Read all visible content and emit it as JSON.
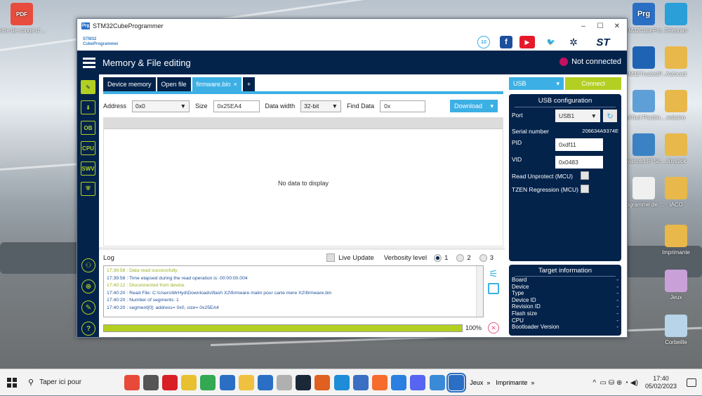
{
  "desktop": {
    "left_icons": [
      {
        "label": "lettre de congé d'un bail non ...",
        "color": "#e74c3c",
        "badge": "PDF"
      }
    ],
    "right_icons": [
      {
        "label": "STM32CubePro...",
        "color": "#2b6fc4",
        "badge": "Prg"
      },
      {
        "label": "Telegram",
        "color": "#2a9fd8",
        "badge": ""
      },
      {
        "label": "STM32TrustedP...",
        "color": "#1f63b5",
        "badge": ""
      },
      {
        "label": "Autocad",
        "color": "#e8b84a",
        "badge": ""
      },
      {
        "label": "MiniTool Partition Wizard",
        "color": "#5f9fd8",
        "badge": ""
      },
      {
        "label": "arduino",
        "color": "#e8b84a",
        "badge": ""
      },
      {
        "label": "Advanced IP Scanner",
        "color": "#3a82c4",
        "badge": ""
      },
      {
        "label": "Joystick",
        "color": "#e8b84a",
        "badge": ""
      },
      {
        "label": "Programme de base relais",
        "color": "#f0f0f0",
        "badge": ""
      },
      {
        "label": "IACO",
        "color": "#e8b84a",
        "badge": ""
      },
      {
        "label": "Imprimante",
        "color": "#e8b84a",
        "badge": ""
      },
      {
        "label": "Jeux",
        "color": "#c9a0d8",
        "badge": ""
      },
      {
        "label": "Corbeille",
        "color": "#b8d4e8",
        "badge": ""
      }
    ]
  },
  "window": {
    "title": "STM32CubeProgrammer",
    "app_badge": "Prg",
    "brand": "STM32CubeProgrammer",
    "brand_logo": [
      "STM32",
      "CubeProgrammer"
    ],
    "controls": {
      "minimize": "–",
      "maximize": "☐",
      "close": "✕"
    },
    "social": {
      "anniversary": "10",
      "facebook": "f",
      "youtube": "▶",
      "twitter": "🐦",
      "network": "✲",
      "st_logo": "ST"
    }
  },
  "header": {
    "title": "Memory & File editing",
    "connection_status": "Not connected"
  },
  "sidebar": [
    {
      "name": "memory-edit",
      "glyph": "✎"
    },
    {
      "name": "erase-program",
      "glyph": "⬇"
    },
    {
      "name": "option-bytes",
      "glyph": "OB"
    },
    {
      "name": "cpu",
      "glyph": "CPU"
    },
    {
      "name": "swv",
      "glyph": "SWV"
    },
    {
      "name": "security",
      "glyph": "⛨"
    }
  ],
  "sidebar_bottom": [
    {
      "name": "notification",
      "glyph": "⚇"
    },
    {
      "name": "debug",
      "glyph": "⊛"
    },
    {
      "name": "edit",
      "glyph": "✎"
    },
    {
      "name": "help",
      "glyph": "?"
    }
  ],
  "main": {
    "tabs": [
      {
        "label": "Device memory",
        "active": false
      },
      {
        "label": "Open file",
        "active": false
      },
      {
        "label": "firmware.bin",
        "active": true,
        "closable": "×"
      },
      {
        "label": "+",
        "active": false
      }
    ],
    "address_label": "Address",
    "address_value": "0x0",
    "size_label": "Size",
    "size_value": "0x25EA4",
    "data_width_label": "Data width",
    "data_width_value": "32-bit",
    "find_label": "Find Data",
    "find_value": "0x",
    "download_label": "Download",
    "no_data": "No data to display"
  },
  "log": {
    "label": "Log",
    "live_update": "Live Update",
    "verbosity_label": "Verbosity level",
    "verbosity_options": [
      "1",
      "2",
      "3"
    ],
    "verbosity_selected": "1",
    "lines": [
      {
        "text": "17:39:58 : Data read successfully",
        "color": "#9aae1f"
      },
      {
        "text": "17:39:58 : Time elapsed during the read operation is: 00:00:00.004",
        "color": "#1f4f9a"
      },
      {
        "text": "17:40:12 : Disconnected from device.",
        "color": "#9aae1f"
      },
      {
        "text": "17:40:20 : Read File: C:\\Users\\MrHyd\\Downloads\\flash X2\\firmware malin pour carte mere X2\\firmware.bin",
        "color": "#1f4f9a"
      },
      {
        "text": "17:40:20 : Number of segments: 1",
        "color": "#1f4f9a"
      },
      {
        "text": "17:40:20 : segment[0]: address= 0x0, size= 0x25EA4",
        "color": "#1f4f9a"
      }
    ],
    "progress": 1.0,
    "progress_label": "100%"
  },
  "right": {
    "interface": "USB",
    "connect_label": "Connect",
    "usb_title": "USB configuration",
    "port_label": "Port",
    "port_value": "USB1",
    "serial_label": "Serial number",
    "serial_value": "206634A9374E",
    "pid_label": "PID",
    "pid_value": "0xdf11",
    "vid_label": "VID",
    "vid_value": "0x0483",
    "read_unprotect": "Read Unprotect (MCU)",
    "tzen": "TZEN Regression (MCU)",
    "target_title": "Target information",
    "target_rows": [
      {
        "label": "Board",
        "value": "-"
      },
      {
        "label": "Device",
        "value": "-"
      },
      {
        "label": "Type",
        "value": "-"
      },
      {
        "label": "Device ID",
        "value": "-"
      },
      {
        "label": "Revision ID",
        "value": "-"
      },
      {
        "label": "Flash size",
        "value": "-"
      },
      {
        "label": "CPU",
        "value": "-"
      },
      {
        "label": "Bootloader Version",
        "value": "-"
      }
    ]
  },
  "taskbar": {
    "search_placeholder": "Taper ici pour",
    "apps": [
      {
        "name": "holiday",
        "color": "#e84a3a"
      },
      {
        "name": "task-view",
        "color": "#555555"
      },
      {
        "name": "netflix",
        "color": "#d81f26"
      },
      {
        "name": "mail-app",
        "color": "#e8c030"
      },
      {
        "name": "chrome",
        "color": "#34a853"
      },
      {
        "name": "mail",
        "color": "#2b6fc4"
      },
      {
        "name": "explorer",
        "color": "#f0c040"
      },
      {
        "name": "store",
        "color": "#2b6fc4"
      },
      {
        "name": "app",
        "color": "#b0b0b0"
      },
      {
        "name": "steam",
        "color": "#1b2838"
      },
      {
        "name": "player",
        "color": "#e06020"
      },
      {
        "name": "edge",
        "color": "#1f8cd8"
      },
      {
        "name": "network-app",
        "color": "#3a6fc4"
      },
      {
        "name": "origin",
        "color": "#f56c2d"
      },
      {
        "name": "messenger",
        "color": "#2b7fe0"
      },
      {
        "name": "discord",
        "color": "#5865f2"
      },
      {
        "name": "app2",
        "color": "#3a8ad8"
      },
      {
        "name": "stm32",
        "color": "#2b6fc4"
      }
    ],
    "toolbars": [
      "Jeux",
      "Imprimante"
    ],
    "toolbar_chevrons": [
      "»",
      "»"
    ],
    "tray_glyphs": "^  ▭ ⛁ ⊕ ◔ ◀)",
    "time": "17:40",
    "date": "05/02/2023"
  }
}
